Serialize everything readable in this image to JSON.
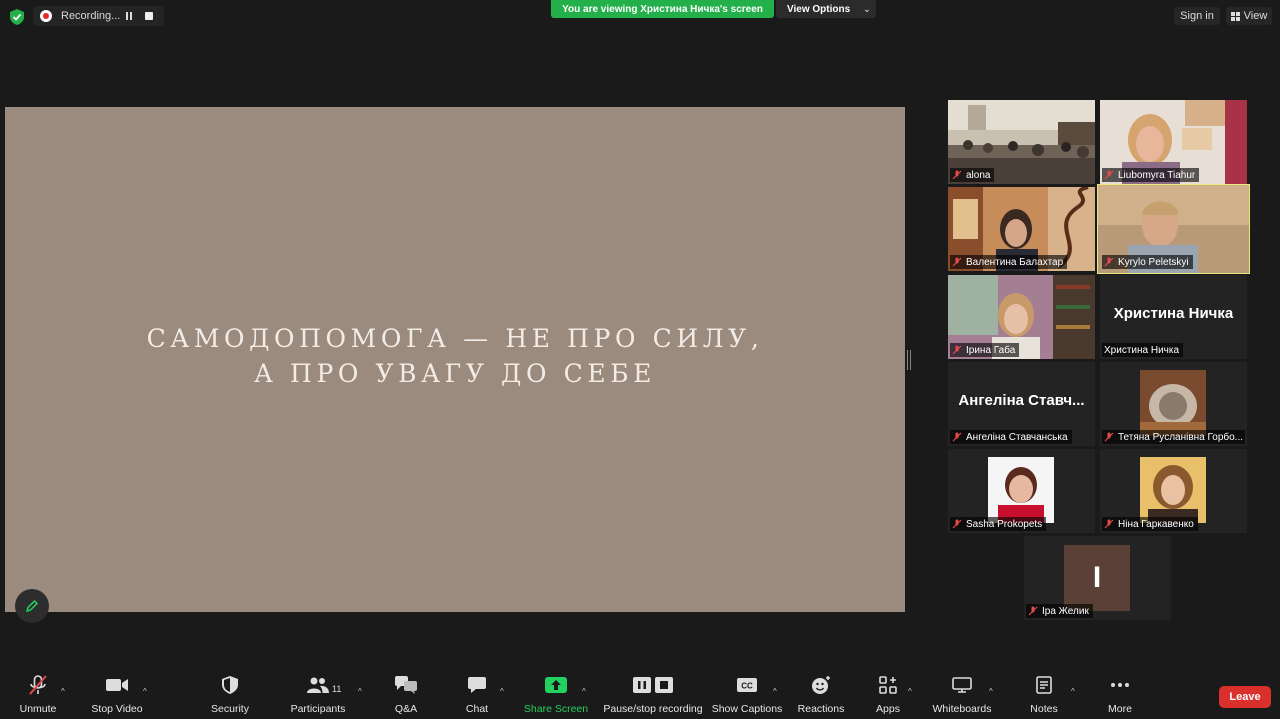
{
  "top": {
    "recording_label": "Recording...",
    "viewing_banner": "You are viewing Христина Ничка's screen",
    "view_options": "View Options",
    "sign_in": "Sign in",
    "view": "View"
  },
  "slide": {
    "line1": "САМОДОПОМОГА — НЕ ПРО СИЛУ,",
    "line2": "А ПРО УВАГУ ДО СЕБЕ"
  },
  "participants": [
    {
      "name": "alona"
    },
    {
      "name": "Liubomyra Tiahur"
    },
    {
      "name": "Валентина Балахтар"
    },
    {
      "name": "Kyrylo Peletskyi"
    },
    {
      "name": "Ірина Габа"
    },
    {
      "name": "Христина Ничка",
      "big_name": "Христина Ничка"
    },
    {
      "name": "Ангеліна Ставчанська",
      "big_name": "Ангеліна Ставч..."
    },
    {
      "name": "Тетяна Русланівна Горбо..."
    },
    {
      "name": "Sasha Prokopets"
    },
    {
      "name": "Ніна Гаркавенко"
    },
    {
      "name": "Іра Желик",
      "initial": "І"
    }
  ],
  "toolbar": {
    "unmute": "Unmute",
    "stop_video": "Stop Video",
    "security": "Security",
    "participants": "Participants",
    "participants_count": "11",
    "qa": "Q&A",
    "chat": "Chat",
    "share_screen": "Share Screen",
    "pause_recording": "Pause/stop recording",
    "show_captions": "Show Captions",
    "reactions": "Reactions",
    "apps": "Apps",
    "whiteboards": "Whiteboards",
    "notes": "Notes",
    "more": "More",
    "leave": "Leave"
  },
  "colors": {
    "banner_green": "#23b04a",
    "slide_bg": "#9b8b7f",
    "active_speaker": "#e9e87a",
    "leave_red": "#d9302c"
  }
}
